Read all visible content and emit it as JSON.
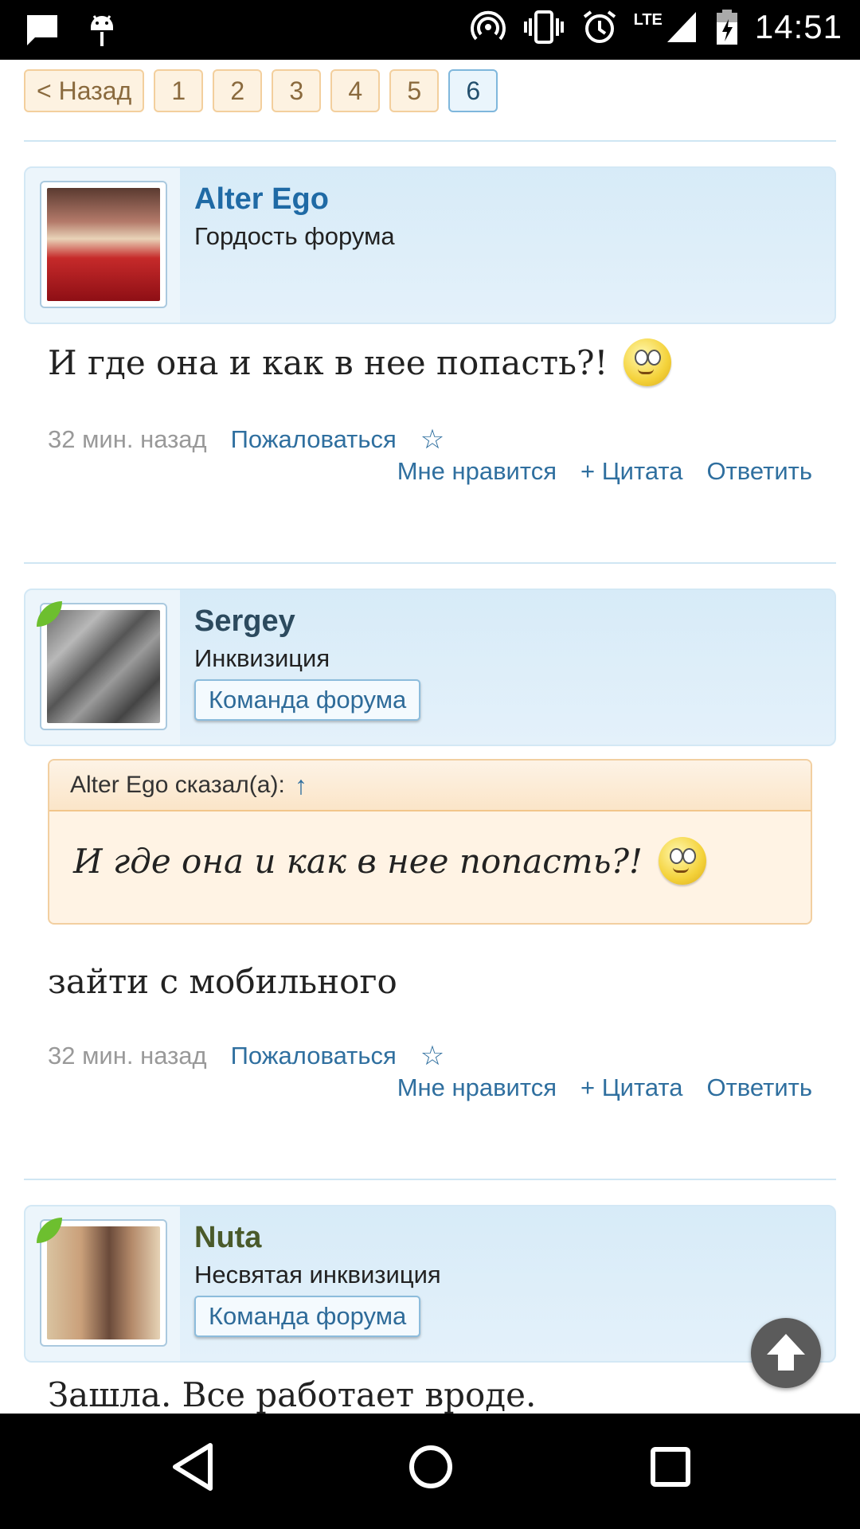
{
  "status_bar": {
    "time": "14:51",
    "network": "LTE",
    "icons": [
      "chat-icon",
      "android-icon",
      "hotspot-icon",
      "vibrate-icon",
      "alarm-icon",
      "signal-icon",
      "battery-charging-icon"
    ]
  },
  "pager": {
    "back_label": "< Назад",
    "pages": [
      "1",
      "2",
      "3",
      "4",
      "5",
      "6"
    ],
    "active_page": "6"
  },
  "posts": [
    {
      "author": "Alter Ego",
      "author_color": "#1f6aa5",
      "rank": "Гордость форума",
      "text": "И где она и как в нее попасть?!",
      "time": "32 мин. назад",
      "report": "Пожаловаться",
      "like": "Мне нравится",
      "quote": "+ Цитата",
      "reply": "Ответить",
      "star": "☆"
    },
    {
      "author": "Sergey",
      "author_color": "#2c4a5e",
      "rank": "Инквизиция",
      "team_badge": "Команда форума",
      "quote_header": "Alter Ego сказал(а):",
      "quote_arrow": "↑",
      "quote_text": "И где она и как в нее попасть?!",
      "text": "зайти с мобильного",
      "time": "32 мин. назад",
      "report": "Пожаловаться",
      "like": "Мне нравится",
      "quote": "+ Цитата",
      "reply": "Ответить",
      "star": "☆"
    },
    {
      "author": "Nuta",
      "author_color": "#4a5a2a",
      "rank": "Несвятая инквизиция",
      "team_badge": "Команда форума",
      "text": "Зашла. Все работает вроде."
    }
  ]
}
